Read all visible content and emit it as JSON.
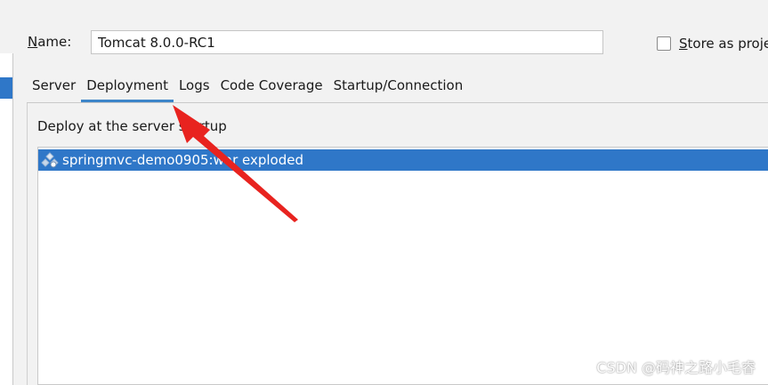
{
  "form": {
    "name_label_mnemonic": "N",
    "name_label_rest": "ame:",
    "name_value": "Tomcat 8.0.0-RC1",
    "store_label_mnemonic": "S",
    "store_label_rest": "tore as proje"
  },
  "tabs": [
    {
      "label": "Server",
      "active": false
    },
    {
      "label": "Deployment",
      "active": true
    },
    {
      "label": "Logs",
      "active": false
    },
    {
      "label": "Code Coverage",
      "active": false
    },
    {
      "label": "Startup/Connection",
      "active": false
    }
  ],
  "deployment": {
    "section_title": "Deploy at the server startup",
    "items": [
      {
        "label": "springmvc-demo0905:war exploded",
        "selected": true,
        "icon": "war-artifact-icon"
      }
    ]
  },
  "annotation": {
    "arrow_color": "#e8231f",
    "icon": "red-arrow-annotation"
  },
  "watermark": {
    "text": "CSDN @码神之路小毛睿"
  },
  "colors": {
    "selection": "#2f77c8",
    "tab_underline": "#3d86c9",
    "background": "#f2f2f2"
  }
}
